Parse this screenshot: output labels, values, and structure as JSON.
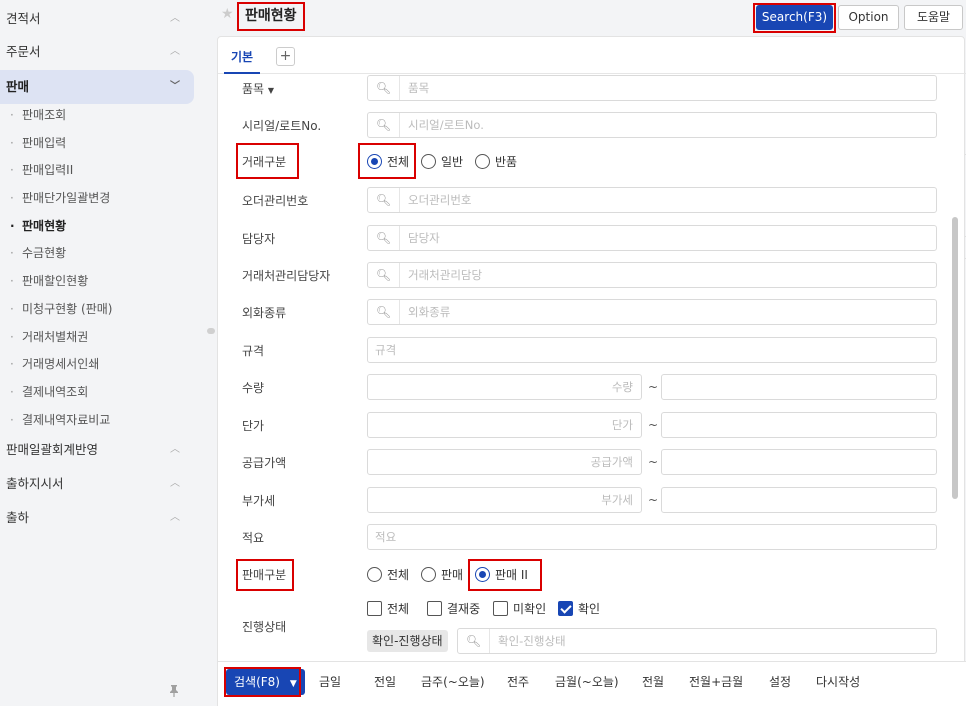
{
  "sidebar": {
    "group_quote": "견적서",
    "group_order": "주문서",
    "group_sales": "판매",
    "sales_items": [
      "판매조회",
      "판매입력",
      "판매입력II",
      "판매단가일괄변경",
      "판매현황",
      "수금현황",
      "판매할인현황",
      "미청구현황 (판매)",
      "거래처별채권",
      "거래명세서인쇄",
      "결제내역조회",
      "결제내역자료비교"
    ],
    "group_batch": "판매일괄회계반영",
    "group_ship_order": "출하지시서",
    "group_ship": "출하"
  },
  "header": {
    "title": "판매현황",
    "search_button": "Search(F3)",
    "option_button": "Option",
    "help_button": "도움말"
  },
  "tabs": {
    "basic": "기본",
    "add": "+"
  },
  "form": {
    "item_label": "품목",
    "item_placeholder": "품목",
    "serial_label": "시리얼/로트No.",
    "serial_placeholder": "시리얼/로트No.",
    "trade_type_label": "거래구분",
    "trade_type_options": [
      "전체",
      "일반",
      "반품"
    ],
    "trade_type_selected": "전체",
    "order_no_label": "오더관리번호",
    "order_no_placeholder": "오더관리번호",
    "manager_label": "담당자",
    "manager_placeholder": "담당자",
    "client_manager_label": "거래처관리담당자",
    "client_manager_placeholder": "거래처관리담당",
    "currency_label": "외화종류",
    "currency_placeholder": "외화종류",
    "spec_label": "규격",
    "spec_placeholder": "규격",
    "qty_label": "수량",
    "qty_placeholder": "수량",
    "price_label": "단가",
    "price_placeholder": "단가",
    "supply_label": "공급가액",
    "supply_placeholder": "공급가액",
    "vat_label": "부가세",
    "vat_placeholder": "부가세",
    "memo_label": "적요",
    "memo_placeholder": "적요",
    "range_sep": "~",
    "sales_type_label": "판매구분",
    "sales_type_options": [
      "전체",
      "판매",
      "판매 II"
    ],
    "sales_type_selected": "판매 II",
    "status_label": "진행상태",
    "status_options": [
      {
        "label": "전체",
        "checked": false
      },
      {
        "label": "결재중",
        "checked": false
      },
      {
        "label": "미확인",
        "checked": false
      },
      {
        "label": "확인",
        "checked": true
      }
    ],
    "status_chip": "확인-진행상태",
    "status_placeholder": "확인-진행상태"
  },
  "footer": {
    "search_label": "검색(F8)",
    "quick_buttons": [
      "금일",
      "전일",
      "금주(~오늘)",
      "전주",
      "금월(~오늘)",
      "전월",
      "전월+금월",
      "설정",
      "다시작성"
    ]
  },
  "colors": {
    "primary": "#1846b4",
    "highlight_box": "#d90000"
  }
}
